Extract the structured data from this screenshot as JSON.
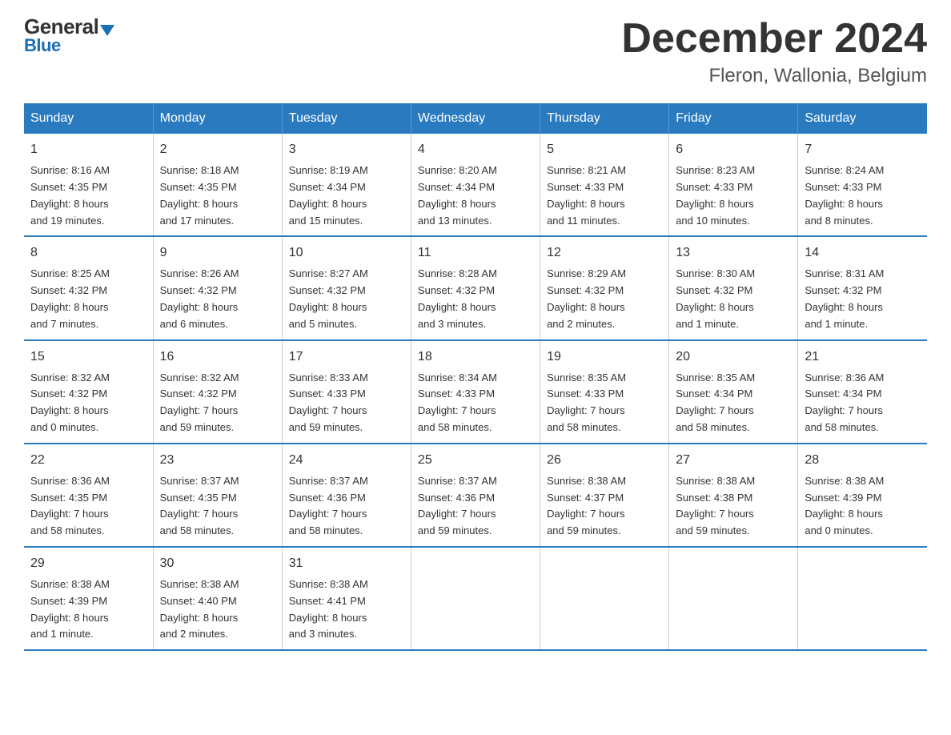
{
  "header": {
    "logo_line1": "General",
    "logo_line2": "Blue",
    "month": "December 2024",
    "location": "Fleron, Wallonia, Belgium"
  },
  "days_of_week": [
    "Sunday",
    "Monday",
    "Tuesday",
    "Wednesday",
    "Thursday",
    "Friday",
    "Saturday"
  ],
  "weeks": [
    [
      {
        "day": "1",
        "info": "Sunrise: 8:16 AM\nSunset: 4:35 PM\nDaylight: 8 hours\nand 19 minutes."
      },
      {
        "day": "2",
        "info": "Sunrise: 8:18 AM\nSunset: 4:35 PM\nDaylight: 8 hours\nand 17 minutes."
      },
      {
        "day": "3",
        "info": "Sunrise: 8:19 AM\nSunset: 4:34 PM\nDaylight: 8 hours\nand 15 minutes."
      },
      {
        "day": "4",
        "info": "Sunrise: 8:20 AM\nSunset: 4:34 PM\nDaylight: 8 hours\nand 13 minutes."
      },
      {
        "day": "5",
        "info": "Sunrise: 8:21 AM\nSunset: 4:33 PM\nDaylight: 8 hours\nand 11 minutes."
      },
      {
        "day": "6",
        "info": "Sunrise: 8:23 AM\nSunset: 4:33 PM\nDaylight: 8 hours\nand 10 minutes."
      },
      {
        "day": "7",
        "info": "Sunrise: 8:24 AM\nSunset: 4:33 PM\nDaylight: 8 hours\nand 8 minutes."
      }
    ],
    [
      {
        "day": "8",
        "info": "Sunrise: 8:25 AM\nSunset: 4:32 PM\nDaylight: 8 hours\nand 7 minutes."
      },
      {
        "day": "9",
        "info": "Sunrise: 8:26 AM\nSunset: 4:32 PM\nDaylight: 8 hours\nand 6 minutes."
      },
      {
        "day": "10",
        "info": "Sunrise: 8:27 AM\nSunset: 4:32 PM\nDaylight: 8 hours\nand 5 minutes."
      },
      {
        "day": "11",
        "info": "Sunrise: 8:28 AM\nSunset: 4:32 PM\nDaylight: 8 hours\nand 3 minutes."
      },
      {
        "day": "12",
        "info": "Sunrise: 8:29 AM\nSunset: 4:32 PM\nDaylight: 8 hours\nand 2 minutes."
      },
      {
        "day": "13",
        "info": "Sunrise: 8:30 AM\nSunset: 4:32 PM\nDaylight: 8 hours\nand 1 minute."
      },
      {
        "day": "14",
        "info": "Sunrise: 8:31 AM\nSunset: 4:32 PM\nDaylight: 8 hours\nand 1 minute."
      }
    ],
    [
      {
        "day": "15",
        "info": "Sunrise: 8:32 AM\nSunset: 4:32 PM\nDaylight: 8 hours\nand 0 minutes."
      },
      {
        "day": "16",
        "info": "Sunrise: 8:32 AM\nSunset: 4:32 PM\nDaylight: 7 hours\nand 59 minutes."
      },
      {
        "day": "17",
        "info": "Sunrise: 8:33 AM\nSunset: 4:33 PM\nDaylight: 7 hours\nand 59 minutes."
      },
      {
        "day": "18",
        "info": "Sunrise: 8:34 AM\nSunset: 4:33 PM\nDaylight: 7 hours\nand 58 minutes."
      },
      {
        "day": "19",
        "info": "Sunrise: 8:35 AM\nSunset: 4:33 PM\nDaylight: 7 hours\nand 58 minutes."
      },
      {
        "day": "20",
        "info": "Sunrise: 8:35 AM\nSunset: 4:34 PM\nDaylight: 7 hours\nand 58 minutes."
      },
      {
        "day": "21",
        "info": "Sunrise: 8:36 AM\nSunset: 4:34 PM\nDaylight: 7 hours\nand 58 minutes."
      }
    ],
    [
      {
        "day": "22",
        "info": "Sunrise: 8:36 AM\nSunset: 4:35 PM\nDaylight: 7 hours\nand 58 minutes."
      },
      {
        "day": "23",
        "info": "Sunrise: 8:37 AM\nSunset: 4:35 PM\nDaylight: 7 hours\nand 58 minutes."
      },
      {
        "day": "24",
        "info": "Sunrise: 8:37 AM\nSunset: 4:36 PM\nDaylight: 7 hours\nand 58 minutes."
      },
      {
        "day": "25",
        "info": "Sunrise: 8:37 AM\nSunset: 4:36 PM\nDaylight: 7 hours\nand 59 minutes."
      },
      {
        "day": "26",
        "info": "Sunrise: 8:38 AM\nSunset: 4:37 PM\nDaylight: 7 hours\nand 59 minutes."
      },
      {
        "day": "27",
        "info": "Sunrise: 8:38 AM\nSunset: 4:38 PM\nDaylight: 7 hours\nand 59 minutes."
      },
      {
        "day": "28",
        "info": "Sunrise: 8:38 AM\nSunset: 4:39 PM\nDaylight: 8 hours\nand 0 minutes."
      }
    ],
    [
      {
        "day": "29",
        "info": "Sunrise: 8:38 AM\nSunset: 4:39 PM\nDaylight: 8 hours\nand 1 minute."
      },
      {
        "day": "30",
        "info": "Sunrise: 8:38 AM\nSunset: 4:40 PM\nDaylight: 8 hours\nand 2 minutes."
      },
      {
        "day": "31",
        "info": "Sunrise: 8:38 AM\nSunset: 4:41 PM\nDaylight: 8 hours\nand 3 minutes."
      },
      {
        "day": "",
        "info": ""
      },
      {
        "day": "",
        "info": ""
      },
      {
        "day": "",
        "info": ""
      },
      {
        "day": "",
        "info": ""
      }
    ]
  ],
  "colors": {
    "header_bg": "#2a7abf",
    "header_text": "#ffffff",
    "border_blue": "#2a7abf"
  }
}
